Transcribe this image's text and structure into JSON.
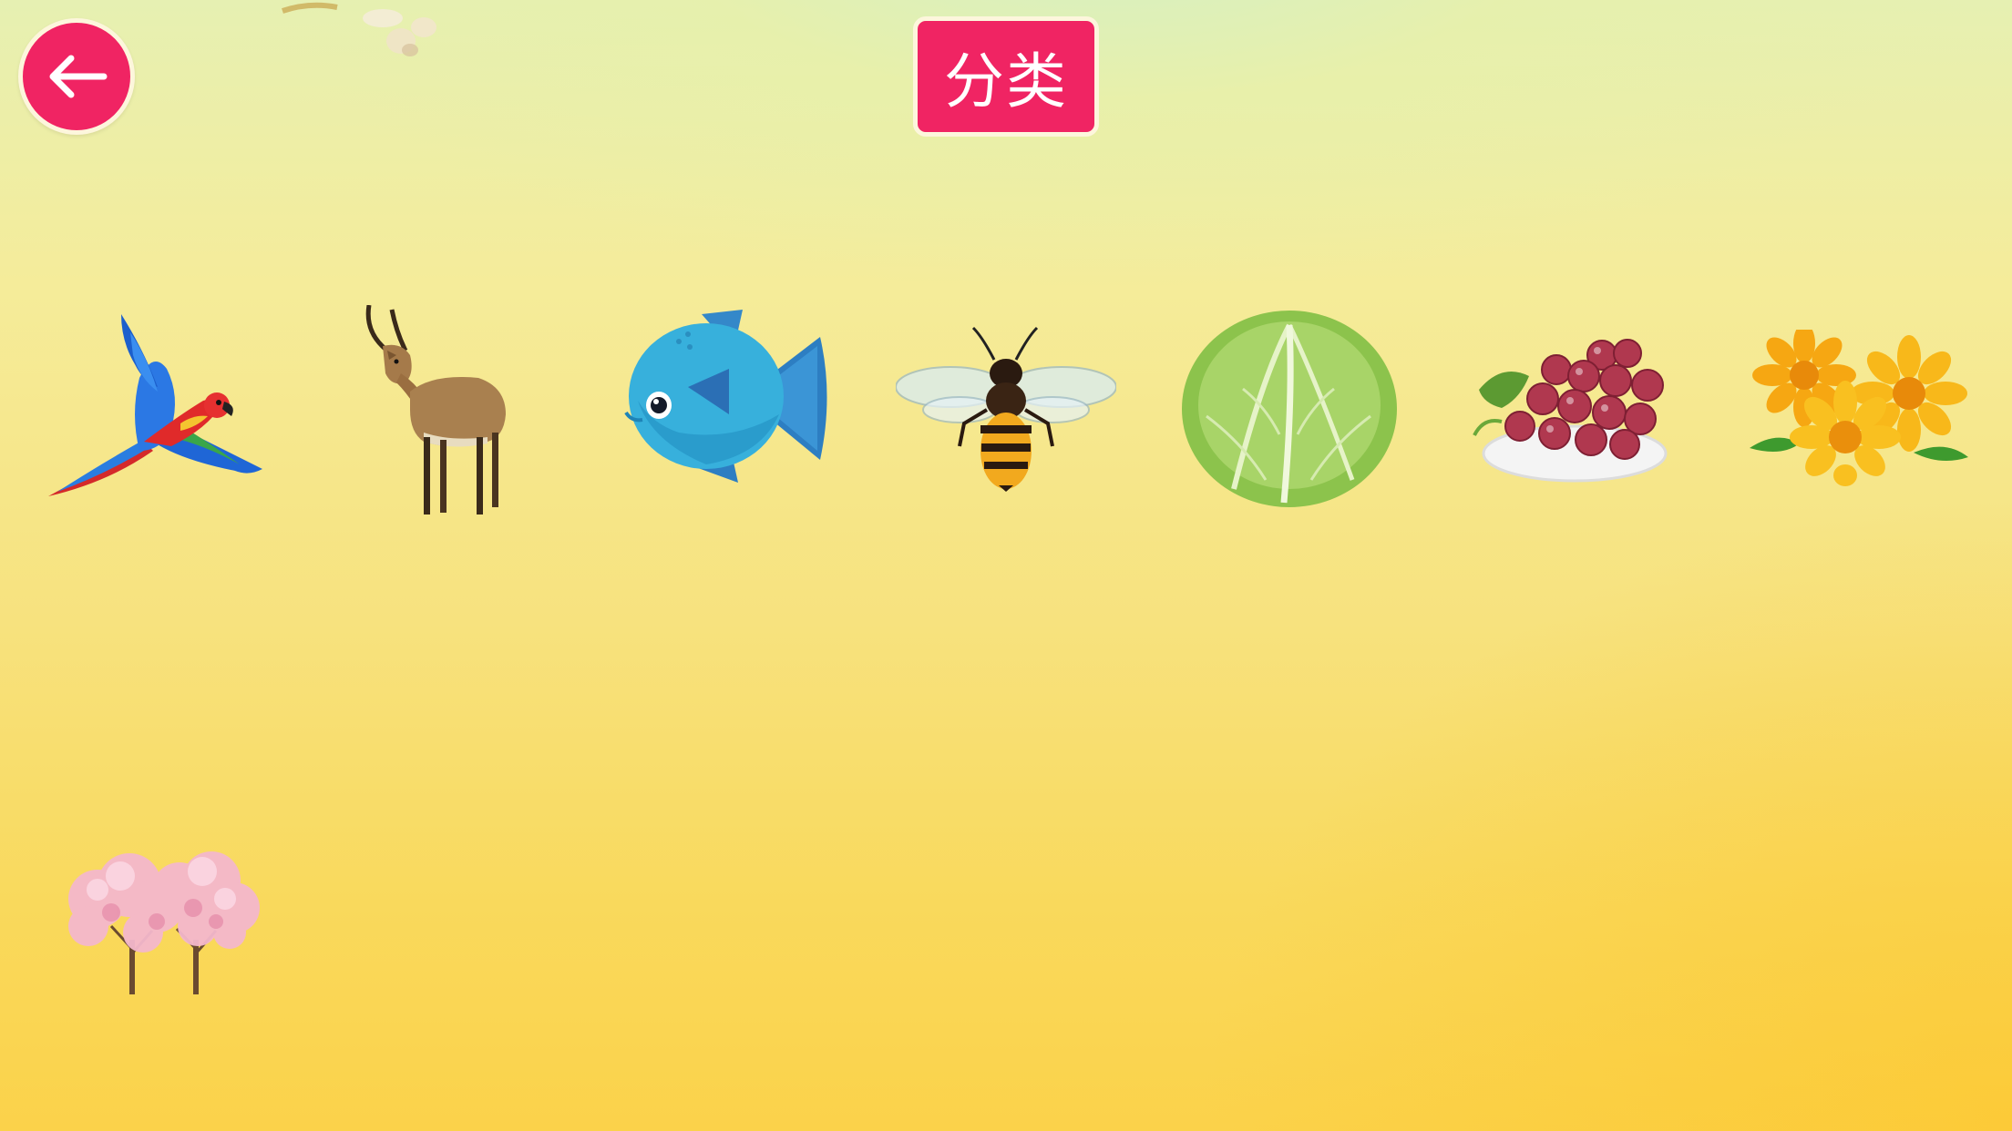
{
  "header": {
    "title": "分类",
    "back_icon": "arrow-left-icon"
  },
  "items": [
    {
      "name": "parrot",
      "icon": "parrot-icon"
    },
    {
      "name": "antelope",
      "icon": "antelope-icon"
    },
    {
      "name": "fish",
      "icon": "fish-icon"
    },
    {
      "name": "bee",
      "icon": "bee-icon"
    },
    {
      "name": "cabbage",
      "icon": "cabbage-icon"
    },
    {
      "name": "grapes",
      "icon": "grapes-icon"
    },
    {
      "name": "flowers",
      "icon": "flowers-icon"
    }
  ],
  "decorations": [
    "cherry-blossom-tree-icon",
    "flower-petal-icon"
  ],
  "colors": {
    "accent": "#f02463",
    "background_top": "#e6f0b2",
    "background_bottom": "#fbd24a"
  }
}
